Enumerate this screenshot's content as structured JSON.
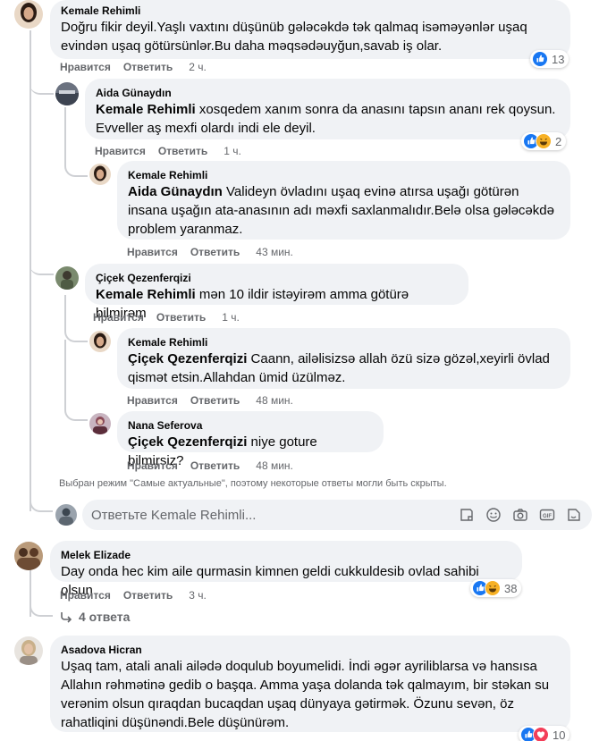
{
  "comments": [
    {
      "author": "Kemale Rehimli",
      "mention": "",
      "text": "Doğru fikir deyil.Yaşlı vaxtını düşünüb gələcəkdə tək qalmaq isəməyənlər uşaq evindən uşaq götürsünlər.Bu daha məqsədəuyğun,savab iş olar.",
      "like": "Нравится",
      "reply": "Ответить",
      "time": "2 ч.",
      "reactions": [
        "like-icon"
      ],
      "reaction_count": "13"
    },
    {
      "author": "Aida Günaydın",
      "mention": "Kemale Rehimli",
      "text": " xosqedem xanım sonra da anasını tapsın ananı rek qoysun. Evveller aş mexfi olardı indi ele deyil.",
      "like": "Нравится",
      "reply": "Ответить",
      "time": "1 ч.",
      "reactions": [
        "like-icon",
        "haha-icon"
      ],
      "reaction_count": "2"
    },
    {
      "author": "Kemale Rehimli",
      "mention": "Aida Günaydın",
      "text": " Valideyn övladını uşaq evinə atırsa uşağı götürən insana uşağın ata-anasının adı məxfi saxlanmalıdır.Belə olsa gələcəkdə problem yaranmaz.",
      "like": "Нравится",
      "reply": "Ответить",
      "time": "43 мин."
    },
    {
      "author": "Çiçek Qezenferqizi",
      "mention": "Kemale Rehimli",
      "text": " mən 10 ildir istəyirəm amma götürə bilmirəm",
      "like": "Нравится",
      "reply": "Ответить",
      "time": "1 ч."
    },
    {
      "author": "Kemale Rehimli",
      "mention": "Çiçek Qezenferqizi",
      "text": " Caann, ailəlisizsə allah özü sizə gözəl,xeyirli övlad qismət etsin.Allahdan ümid üzülməz.",
      "like": "Нравится",
      "reply": "Ответить",
      "time": "48 мин."
    },
    {
      "author": "Nana Seferova",
      "mention": "Çiçek Qezenferqizi",
      "text": " niye goture bilmirsiz?",
      "like": "Нравится",
      "reply": "Ответить",
      "time": "48 мин."
    },
    {
      "author": "Melek Elizade",
      "mention": "",
      "text": "Day onda hec kim aile qurmasin kimnen geldi cukkuldesib ovlad sahibi olsun",
      "like": "Нравится",
      "reply": "Ответить",
      "time": "3 ч.",
      "reactions": [
        "like-icon",
        "haha-icon"
      ],
      "reaction_count": "38"
    },
    {
      "author": "Asadova Hicran",
      "mention": "",
      "text": "Uşaq tam, atali anali ailədə doqulub boyumelidi. İndi əgər ayriliblarsa və hansısa Allahın rəhmətinə gedib o başqa. Amma yaşa dolanda tək qalmayım, bir stəkan su verənim olsun qıraqdan bucaqdan uşaq dünyaya gətirmək. Özunu sevən, öz rahatliqini düşünəndi.Bele düşünürəm.",
      "reactions": [
        "like-icon",
        "love-icon"
      ],
      "reaction_count": "10"
    }
  ],
  "notice": "Выбран режим \"Самые актуальные\", поэтому некоторые ответы могли быть скрыты.",
  "reply_box": {
    "placeholder": "Ответьте Kemale Rehimli...",
    "tools": [
      "sticker-icon",
      "emoji-icon",
      "camera-icon",
      "gif-icon",
      "sticker-pack-icon"
    ]
  },
  "more_replies": "4 ответа",
  "colors": {
    "like": "#1877f2",
    "haha": "#f7b125",
    "love": "#f33e58",
    "bubble": "#f0f2f5",
    "meta": "#65676b"
  }
}
